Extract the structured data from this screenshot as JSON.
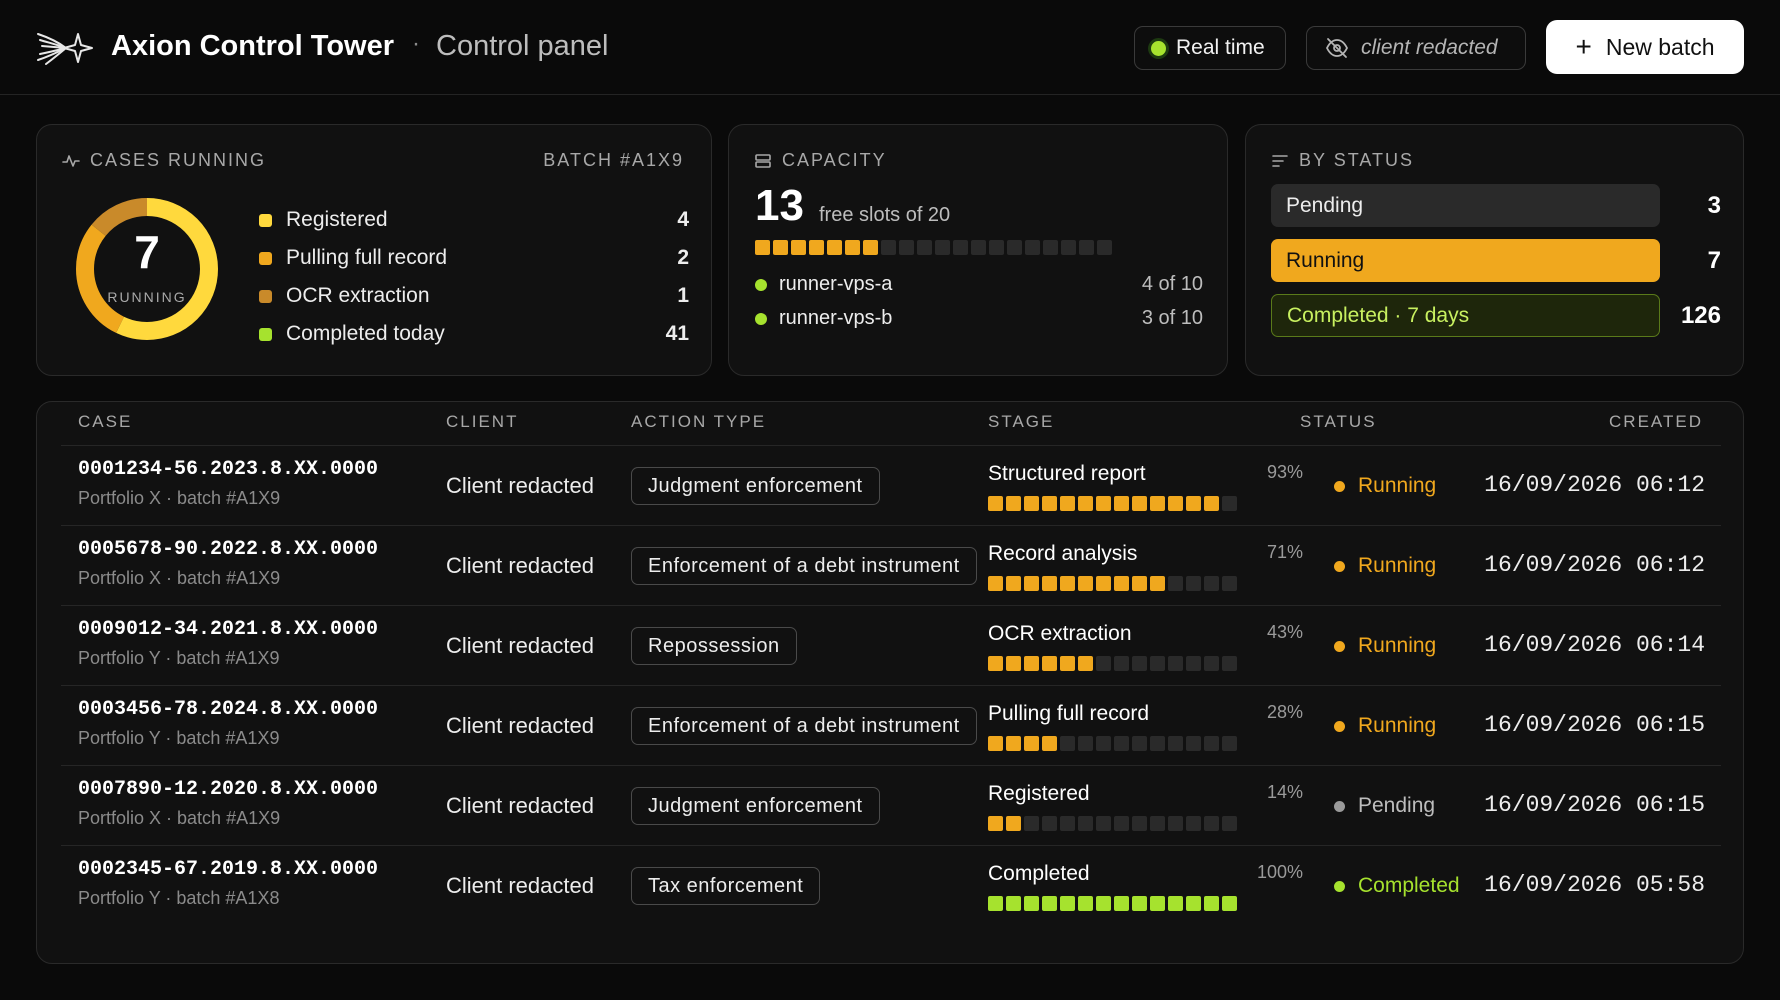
{
  "header": {
    "brand": "Axion Control Tower",
    "separator": "·",
    "subtitle": "Control panel",
    "realtime_label": "Real time",
    "client_label": "client redacted",
    "new_batch_label": "New batch"
  },
  "colors": {
    "accent_yellow": "#f0a81e",
    "bright_yellow": "#ffd93d",
    "ocr_brown": "#c98a2a",
    "green": "#a6e22e",
    "pending_gray": "#9a9a9a"
  },
  "cases_card": {
    "title": "Cases running",
    "batch": "BATCH #A1X9",
    "running_count": "7",
    "running_label": "RUNNING",
    "legend": [
      {
        "label": "Registered",
        "value": "4",
        "color": "#ffd93d"
      },
      {
        "label": "Pulling full record",
        "value": "2",
        "color": "#f0a81e"
      },
      {
        "label": "OCR extraction",
        "value": "1",
        "color": "#c98a2a"
      },
      {
        "label": "Completed today",
        "value": "41",
        "color": "#a6e22e"
      }
    ]
  },
  "capacity_card": {
    "title": "Capacity",
    "free_slots": "13",
    "free_slots_text": "free slots of 20",
    "used_slots": 7,
    "total_slots": 20,
    "runners": [
      {
        "name": "runner-vps-a",
        "usage": "4 of 10"
      },
      {
        "name": "runner-vps-b",
        "usage": "3 of 10"
      }
    ]
  },
  "status_card": {
    "title": "By status",
    "items": [
      {
        "label": "Pending",
        "value": "3"
      },
      {
        "label": "Running",
        "value": "7"
      },
      {
        "label": "Completed · 7 days",
        "value": "126"
      }
    ]
  },
  "table": {
    "columns": [
      "Case",
      "Client",
      "Action type",
      "Stage",
      "Status",
      "Created"
    ],
    "rows": [
      {
        "case": "0001234-56.2023.8.XX.0000",
        "meta": "Portfolio X · batch #A1X9",
        "client": "Client redacted",
        "action": "Judgment enforcement",
        "stage": "Structured report",
        "pct": "93%",
        "progress": 0.93,
        "status": "Running",
        "created": "16/09/2026 06:12"
      },
      {
        "case": "0005678-90.2022.8.XX.0000",
        "meta": "Portfolio X · batch #A1X9",
        "client": "Client redacted",
        "action": "Enforcement of a debt instrument",
        "stage": "Record analysis",
        "pct": "71%",
        "progress": 0.71,
        "status": "Running",
        "created": "16/09/2026 06:12"
      },
      {
        "case": "0009012-34.2021.8.XX.0000",
        "meta": "Portfolio Y · batch #A1X9",
        "client": "Client redacted",
        "action": "Repossession",
        "stage": "OCR extraction",
        "pct": "43%",
        "progress": 0.43,
        "status": "Running",
        "created": "16/09/2026 06:14"
      },
      {
        "case": "0003456-78.2024.8.XX.0000",
        "meta": "Portfolio Y · batch #A1X9",
        "client": "Client redacted",
        "action": "Enforcement of a debt instrument",
        "stage": "Pulling full record",
        "pct": "28%",
        "progress": 0.28,
        "status": "Running",
        "created": "16/09/2026 06:15"
      },
      {
        "case": "0007890-12.2020.8.XX.0000",
        "meta": "Portfolio X · batch #A1X9",
        "client": "Client redacted",
        "action": "Judgment enforcement",
        "stage": "Registered",
        "pct": "14%",
        "progress": 0.14,
        "status": "Pending",
        "created": "16/09/2026 06:15"
      },
      {
        "case": "0002345-67.2019.8.XX.0000",
        "meta": "Portfolio Y · batch #A1X8",
        "client": "Client redacted",
        "action": "Tax enforcement",
        "stage": "Completed",
        "pct": "100%",
        "progress": 1.0,
        "status": "Completed",
        "created": "16/09/2026 05:58"
      }
    ]
  }
}
